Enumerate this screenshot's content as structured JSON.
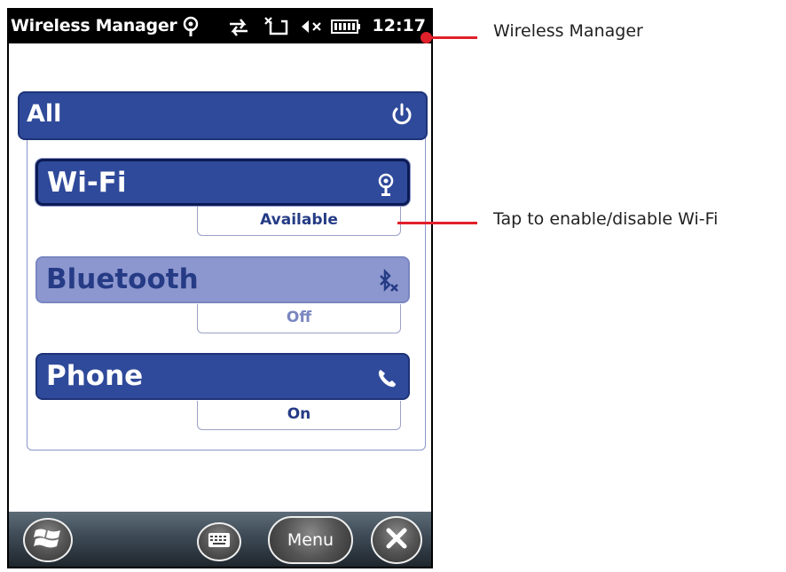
{
  "device": {
    "title": "Wireless Manager",
    "clock": "12:17",
    "status_icons": [
      "wifi-signal-icon",
      "sync-arrows-icon",
      "no-signal-icon",
      "speaker-muted-icon",
      "battery-icon"
    ]
  },
  "panel": {
    "all_label": "All",
    "all_icon": "power-icon",
    "items": [
      {
        "label": "Wi-Fi",
        "status": "Available",
        "icon": "wifi-icon",
        "state": "active"
      },
      {
        "label": "Bluetooth",
        "status": "Off",
        "icon": "bluetooth-off-icon",
        "state": "disabled"
      },
      {
        "label": "Phone",
        "status": "On",
        "icon": "phone-icon",
        "state": "on"
      }
    ]
  },
  "softkeys": {
    "start_icon": "windows-start-icon",
    "keyboard_icon": "keyboard-icon",
    "menu_label": "Menu",
    "close_icon": "close-icon"
  },
  "callouts": {
    "title": "Wireless Manager",
    "wifi": "Tap to enable/disable Wi-Fi"
  },
  "colors": {
    "accent": "#2f4a9a",
    "disabled": "#8d97cf",
    "callout": "#e0202a"
  }
}
